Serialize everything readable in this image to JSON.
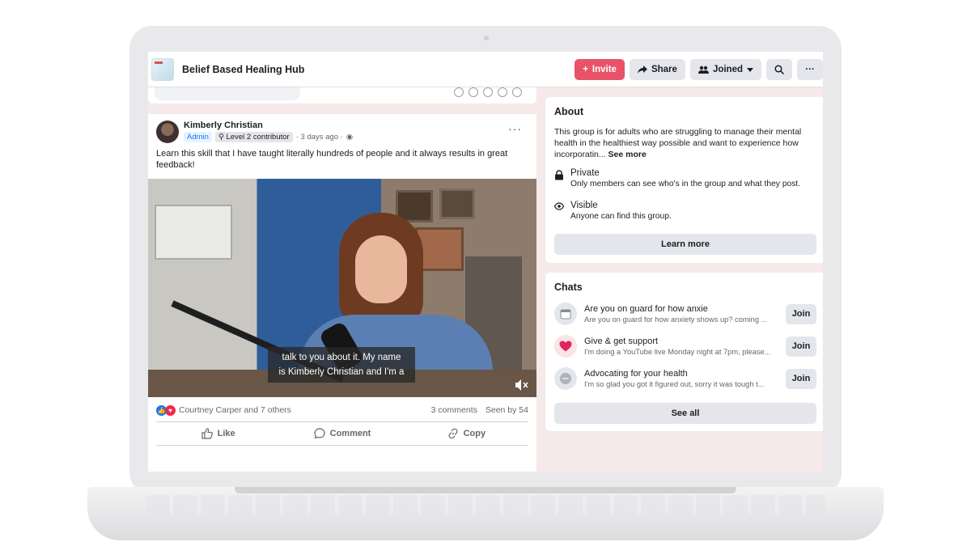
{
  "topbar": {
    "group_name": "Belief Based Healing Hub",
    "invite_label": "Invite",
    "share_label": "Share",
    "joined_label": "Joined",
    "accent": "#e8536a"
  },
  "post": {
    "author": "Kimberly Christian",
    "role_badge": "Admin",
    "level_badge": "Level 2 contributor",
    "time": "· 3 days ago ·",
    "text": "Learn this skill that I have taught literally hundreds of people and it always results in great feedback!",
    "caption": "talk to you about it. My name\nis Kimberly Christian and I'm a",
    "reactions_text": "Courtney Carper and 7 others",
    "comments_count": "3 comments",
    "seen_by": "Seen by 54",
    "actions": {
      "like": "Like",
      "comment": "Comment",
      "copy": "Copy"
    }
  },
  "about": {
    "heading": "About",
    "description": "This group is for adults who are struggling to manage their mental health in the healthiest way possible and want to experience how incorporatin...",
    "see_more": "See more",
    "private_title": "Private",
    "private_desc": "Only members can see who's in the group and what they post.",
    "visible_title": "Visible",
    "visible_desc": "Anyone can find this group.",
    "learn_more": "Learn more"
  },
  "chats": {
    "heading": "Chats",
    "items": [
      {
        "title": "Are you on guard for how anxie",
        "preview": "Are you on guard for how anxiety shows up? coming ...",
        "join": "Join",
        "icon": "calendar-icon"
      },
      {
        "title": "Give & get support",
        "preview": "I'm doing a YouTube live Monday night at 7pm, please...",
        "join": "Join",
        "icon": "heart-icon"
      },
      {
        "title": "Advocating for your health",
        "preview": "I'm so glad you got it figured out, sorry it was tough t...",
        "join": "Join",
        "icon": "chat-bubble-icon"
      }
    ],
    "see_all": "See all"
  }
}
